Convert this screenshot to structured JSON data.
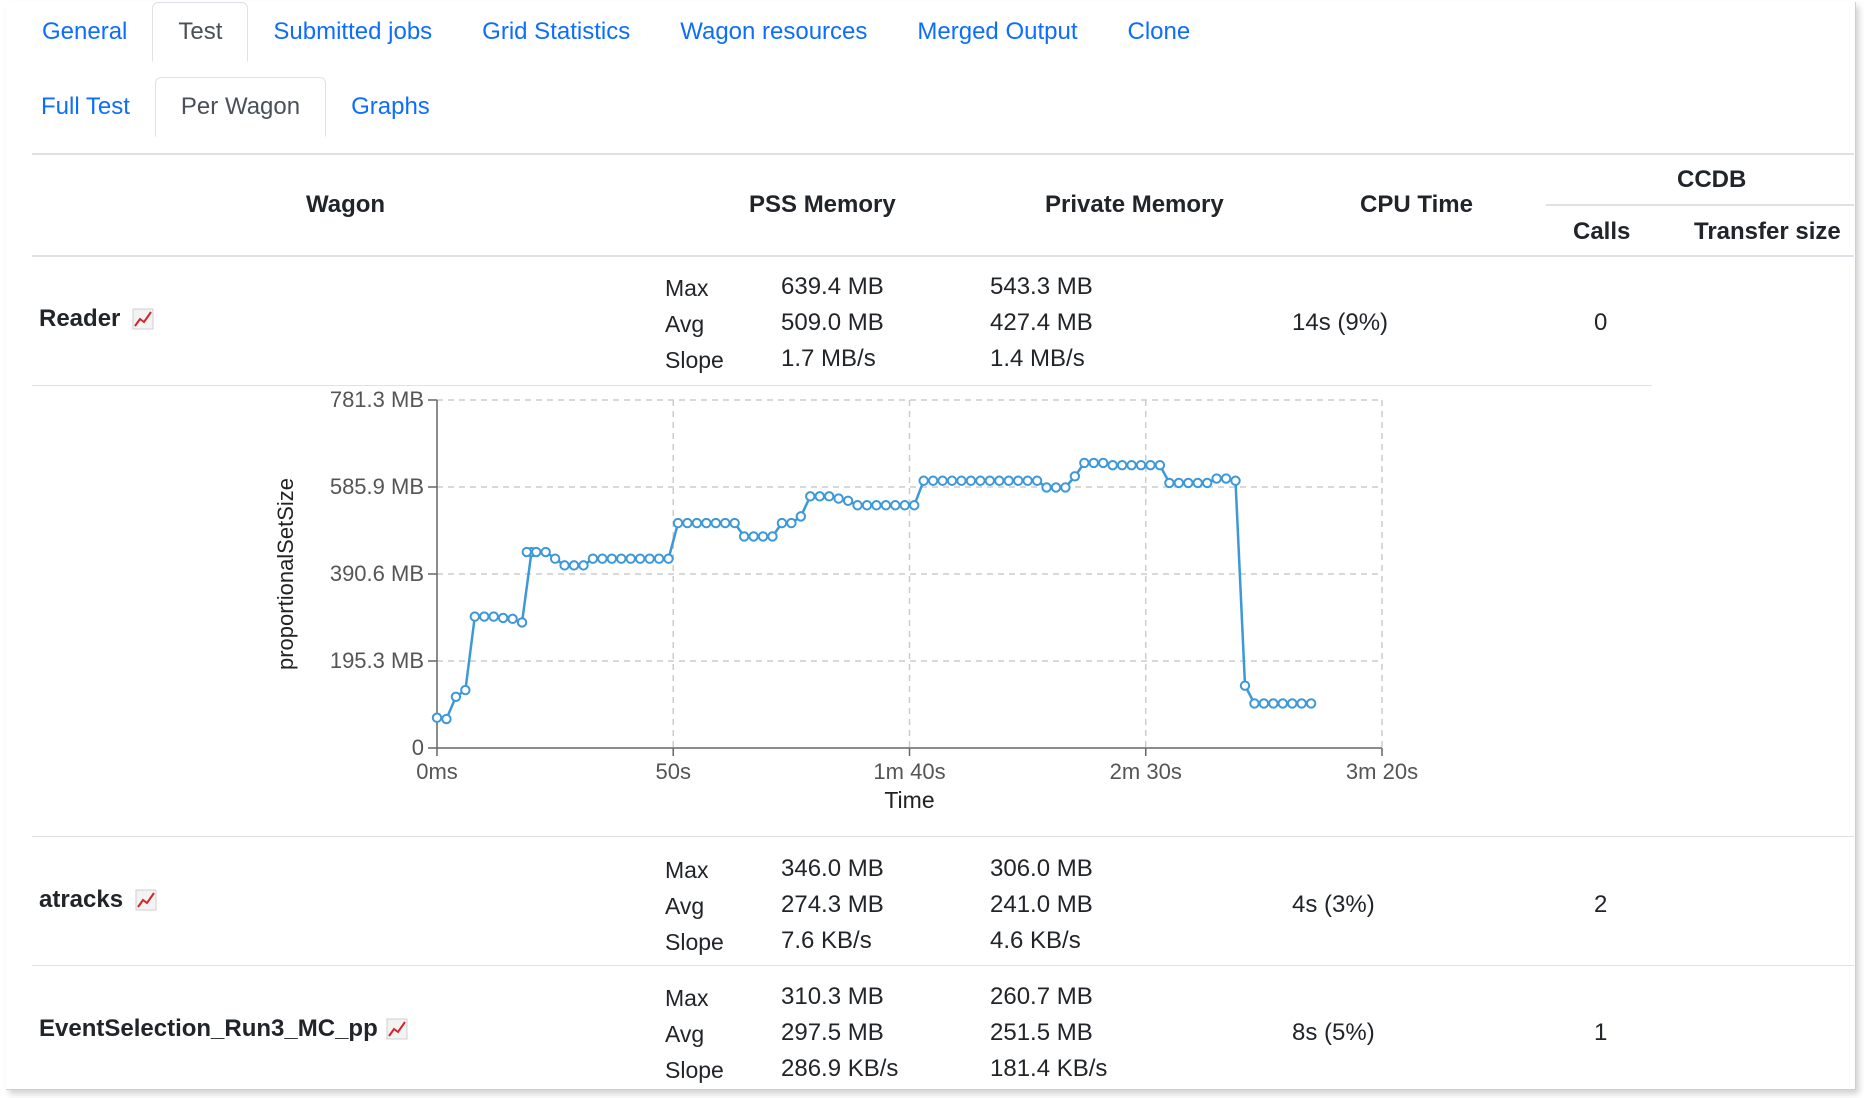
{
  "main_tabs": [
    {
      "label": "General",
      "active": false
    },
    {
      "label": "Test",
      "active": true
    },
    {
      "label": "Submitted jobs",
      "active": false
    },
    {
      "label": "Grid Statistics",
      "active": false
    },
    {
      "label": "Wagon resources",
      "active": false
    },
    {
      "label": "Merged Output",
      "active": false
    },
    {
      "label": "Clone",
      "active": false
    }
  ],
  "sub_tabs": [
    {
      "label": "Full Test",
      "active": false
    },
    {
      "label": "Per Wagon",
      "active": true
    },
    {
      "label": "Graphs",
      "active": false
    }
  ],
  "table": {
    "headers": {
      "wagon": "Wagon",
      "pss": "PSS Memory",
      "private": "Private Memory",
      "cpu": "CPU Time",
      "ccdb": "CCDB",
      "calls": "Calls",
      "transfer": "Transfer size"
    },
    "stat_labels": [
      "Max",
      "Avg",
      "Slope"
    ],
    "rows": [
      {
        "name": "Reader",
        "pss": [
          "639.4 MB",
          "509.0 MB",
          "1.7 MB/s"
        ],
        "private": [
          "543.3 MB",
          "427.4 MB",
          "1.4 MB/s"
        ],
        "cpu": "14s (9%)",
        "calls": "0",
        "chart_icon": "chart-line-icon"
      },
      {
        "name": "atracks",
        "pss": [
          "346.0 MB",
          "274.3 MB",
          "7.6 KB/s"
        ],
        "private": [
          "306.0 MB",
          "241.0 MB",
          "4.6 KB/s"
        ],
        "cpu": "4s (3%)",
        "calls": "2",
        "chart_icon": "chart-line-icon"
      },
      {
        "name": "EventSelection_Run3_MC_pp",
        "pss": [
          "310.3 MB",
          "297.5 MB",
          "286.9 KB/s"
        ],
        "private": [
          "260.7 MB",
          "251.5 MB",
          "181.4 KB/s"
        ],
        "cpu": "8s (5%)",
        "calls": "1",
        "chart_icon": "chart-line-icon"
      }
    ]
  },
  "chart_data": {
    "type": "line",
    "xlabel": "Time",
    "ylabel": "proportionalSetSize",
    "xlim": [
      0,
      200
    ],
    "ylim": [
      0,
      781.3
    ],
    "x_ticks": [
      "0ms",
      "50s",
      "1m 40s",
      "2m 30s",
      "3m 20s"
    ],
    "y_ticks": [
      "0",
      "195.3 MB",
      "390.6 MB",
      "585.9 MB",
      "781.3 MB"
    ],
    "grid": true,
    "color": "#3c98d8",
    "x": [
      0,
      2,
      4,
      6,
      8,
      10,
      12,
      14,
      16,
      18,
      20,
      19,
      21,
      23,
      25,
      27,
      29,
      31,
      33,
      35,
      37,
      39,
      41,
      43,
      45,
      47,
      49,
      51,
      53,
      55,
      57,
      59,
      61,
      63,
      65,
      67,
      69,
      71,
      73,
      75,
      77,
      79,
      81,
      83,
      85,
      87,
      89,
      91,
      93,
      95,
      97,
      99,
      101,
      103,
      105,
      107,
      109,
      111,
      113,
      115,
      117,
      119,
      121,
      123,
      125,
      127,
      129,
      131,
      133,
      135,
      137,
      139,
      141,
      143,
      145,
      147,
      149,
      151,
      153,
      155,
      157,
      159,
      161,
      163,
      165,
      167,
      169,
      171,
      173,
      175,
      177,
      179,
      181,
      183,
      185
    ],
    "y": [
      68,
      65,
      115,
      130,
      295,
      295,
      295,
      292,
      290,
      282,
      440,
      440,
      440,
      440,
      425,
      410,
      410,
      410,
      425,
      425,
      425,
      425,
      425,
      425,
      425,
      425,
      425,
      505,
      505,
      505,
      505,
      505,
      505,
      505,
      475,
      475,
      475,
      475,
      505,
      505,
      520,
      565,
      565,
      565,
      560,
      555,
      545,
      545,
      545,
      545,
      545,
      545,
      545,
      600,
      600,
      600,
      600,
      600,
      600,
      600,
      600,
      600,
      600,
      600,
      600,
      600,
      585,
      585,
      585,
      610,
      640,
      640,
      640,
      635,
      635,
      635,
      635,
      635,
      635,
      595,
      595,
      595,
      595,
      595,
      605,
      605,
      600,
      140,
      100,
      100,
      100,
      100,
      100,
      100,
      100
    ]
  }
}
